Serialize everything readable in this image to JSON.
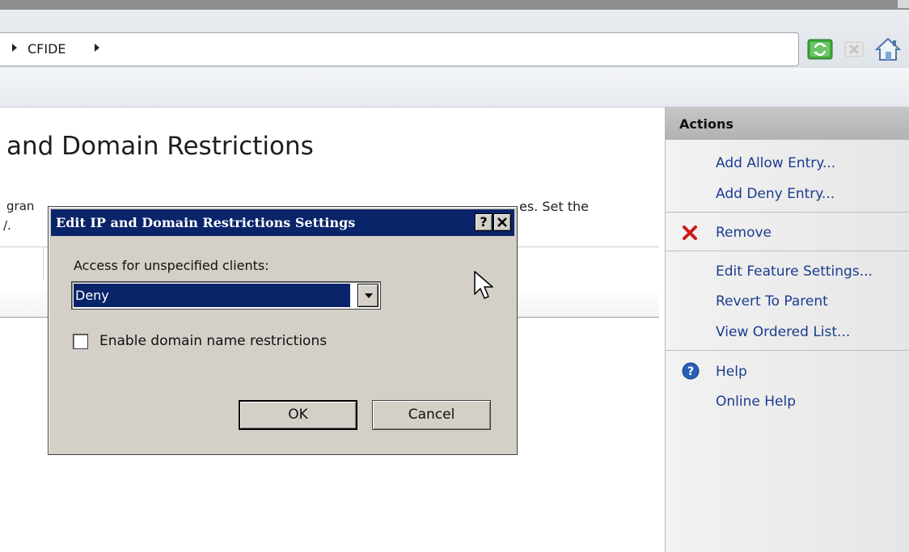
{
  "address": {
    "breadcrumb": [
      "CFIDE"
    ]
  },
  "page": {
    "title": "and Domain Restrictions",
    "desc_line1_left": "gran",
    "desc_line1_right": "es. Set the",
    "desc_line2": "/."
  },
  "actions": {
    "title": "Actions",
    "items": [
      {
        "label": "Add Allow Entry..."
      },
      {
        "label": "Add Deny Entry..."
      },
      {
        "label": "Remove"
      },
      {
        "label": "Edit Feature Settings..."
      },
      {
        "label": "Revert To Parent"
      },
      {
        "label": "View Ordered List..."
      },
      {
        "label": "Help"
      },
      {
        "label": "Online Help"
      }
    ]
  },
  "dialog": {
    "title": "Edit IP and Domain Restrictions Settings",
    "help_button": "?",
    "close_button": "✕",
    "access_label": "Access for unspecified clients:",
    "access_value": "Deny",
    "checkbox_label": "Enable domain name restrictions",
    "checkbox_checked": false,
    "ok_label": "OK",
    "cancel_label": "Cancel"
  },
  "colors": {
    "dialog_title_bg": "#0a246a",
    "link": "#1a3c8f",
    "remove_icon": "#cc1a1a",
    "help_icon": "#2a5fb8"
  },
  "icons": {
    "toolbar": [
      "refresh-icon",
      "stop-icon",
      "home-icon"
    ],
    "remove": "red-x-icon",
    "help": "help-icon"
  }
}
